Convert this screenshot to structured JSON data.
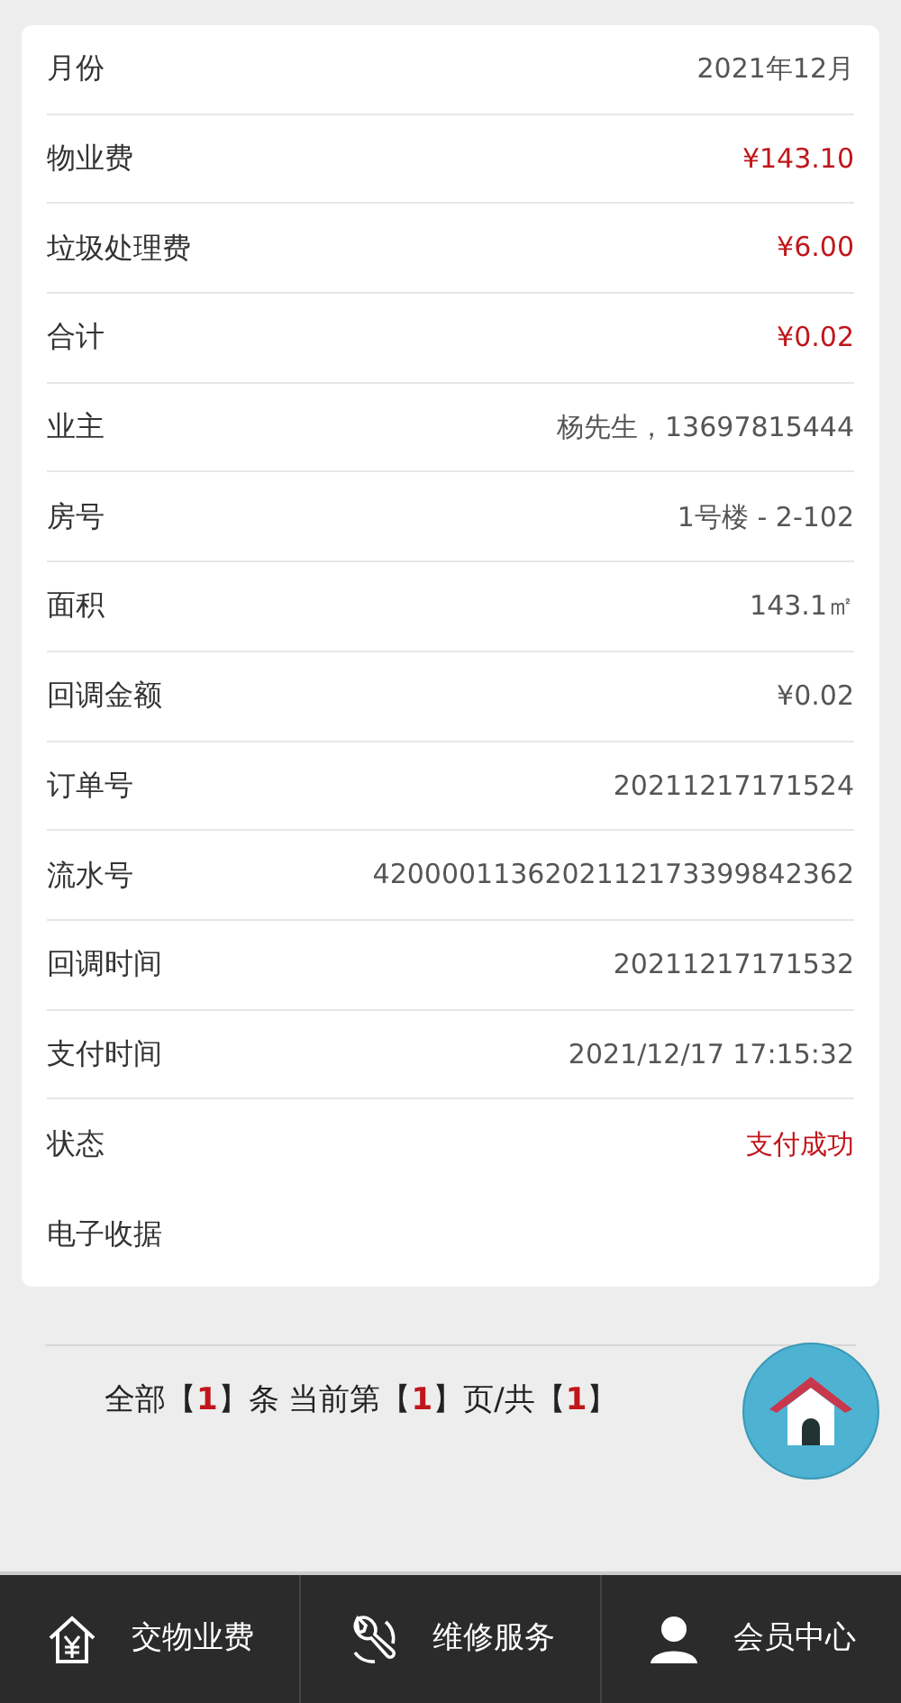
{
  "details": [
    {
      "label": "月份",
      "value": "2021年12月",
      "highlight": false
    },
    {
      "label": "物业费",
      "value": "¥143.10",
      "highlight": true
    },
    {
      "label": "垃圾处理费",
      "value": "¥6.00",
      "highlight": true
    },
    {
      "label": "合计",
      "value": "¥0.02",
      "highlight": true
    },
    {
      "label": "业主",
      "value": "杨先生，13697815444",
      "highlight": false
    },
    {
      "label": "房号",
      "value": "1号楼 - 2-102",
      "highlight": false
    },
    {
      "label": "面积",
      "value": "143.1㎡",
      "highlight": false
    },
    {
      "label": "回调金额",
      "value": "¥0.02",
      "highlight": false
    },
    {
      "label": "订单号",
      "value": "20211217171524",
      "highlight": false
    },
    {
      "label": "流水号",
      "value": "4200001136202112173399842362",
      "highlight": false
    },
    {
      "label": "回调时间",
      "value": "20211217171532",
      "highlight": false
    },
    {
      "label": "支付时间",
      "value": "2021/12/17 17:15:32",
      "highlight": false
    },
    {
      "label": "状态",
      "value": "支付成功",
      "highlight": true
    },
    {
      "label": "电子收据"
    }
  ],
  "pagination": [
    {
      "kind": "text",
      "text": "全部【"
    },
    {
      "kind": "number",
      "text": "1"
    },
    {
      "kind": "text",
      "text": "】条 当前第【"
    },
    {
      "kind": "number",
      "text": "1"
    },
    {
      "kind": "text",
      "text": "】页/共【"
    },
    {
      "kind": "number",
      "text": "1"
    },
    {
      "kind": "text",
      "text": "】"
    }
  ],
  "bottom_nav": [
    {
      "kind": "fee",
      "label": "交物业费"
    },
    {
      "kind": "repair",
      "label": "维修服务"
    },
    {
      "kind": "member",
      "label": "会员中心"
    }
  ]
}
